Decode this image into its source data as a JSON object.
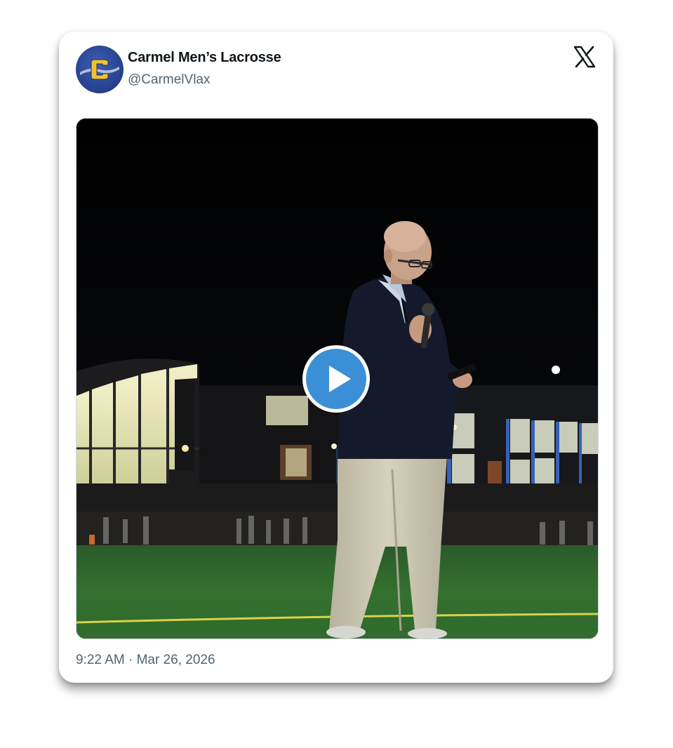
{
  "tweet": {
    "author_name": "Carmel Men’s Lacrosse",
    "author_handle": "@CarmelVlax",
    "timestamp": "9:22 AM · Mar 26, 2026",
    "avatar_icon": "carmel-c-logo",
    "platform_icon": "x-logo-icon",
    "media_type": "video",
    "media_control_icon": "play-icon"
  },
  "colors": {
    "avatar_bg": "#253f8c",
    "avatar_letter": "#f2c230",
    "play_button": "#3b8fd6",
    "text_primary": "#0f1419",
    "text_secondary": "#536471"
  }
}
